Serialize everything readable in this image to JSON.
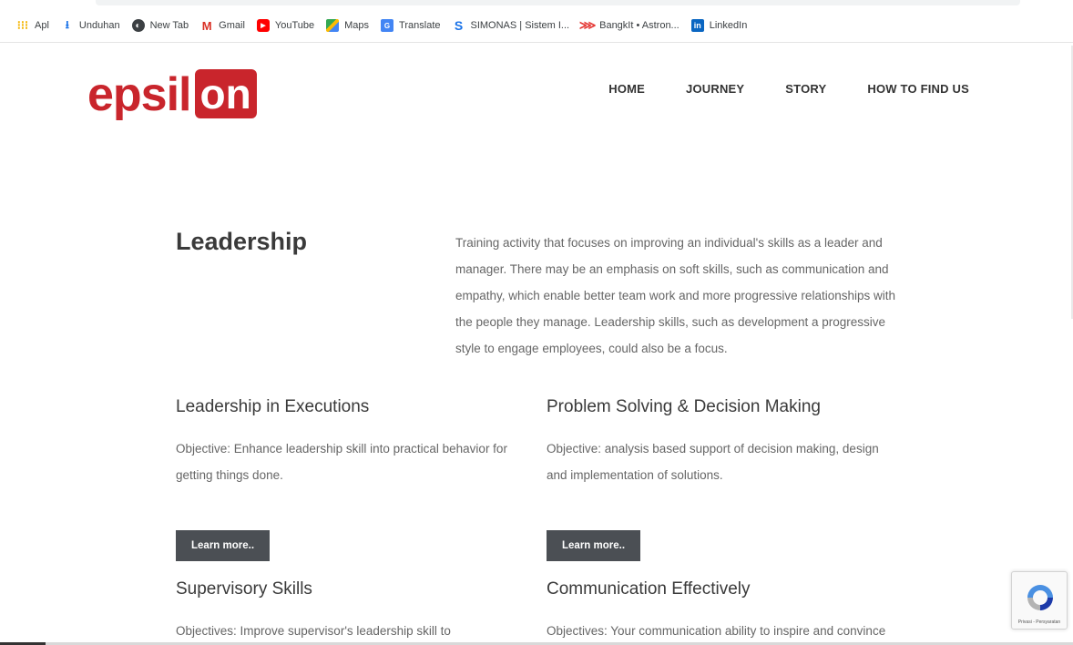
{
  "bookmarks": [
    {
      "label": "Apl",
      "icon": "apps-grid-icon",
      "color": "#f4b400"
    },
    {
      "label": "Unduhan",
      "icon": "download-icon",
      "color": "#1a73e8"
    },
    {
      "label": "New Tab",
      "icon": "globe-icon",
      "color": "#3c4043"
    },
    {
      "label": "Gmail",
      "icon": "gmail-icon",
      "color": "#d93025"
    },
    {
      "label": "YouTube",
      "icon": "youtube-icon",
      "color": "#ff0000"
    },
    {
      "label": "Maps",
      "icon": "maps-icon",
      "color": "#34a853"
    },
    {
      "label": "Translate",
      "icon": "translate-icon",
      "color": "#4285f4"
    },
    {
      "label": "SIMONAS | Sistem I...",
      "icon": "simonas-icon",
      "color": "#1a73e8"
    },
    {
      "label": "BangkIt • Astron...",
      "icon": "bangkit-icon",
      "color": "#e53935"
    },
    {
      "label": "LinkedIn",
      "icon": "linkedin-icon",
      "color": "#0a66c2"
    }
  ],
  "logo": {
    "part1": "epsil",
    "part2": "on",
    "color": "#c9252c"
  },
  "nav": [
    {
      "label": "HOME"
    },
    {
      "label": "JOURNEY"
    },
    {
      "label": "STORY"
    },
    {
      "label": "HOW TO FIND US"
    }
  ],
  "intro": {
    "title": "Leadership",
    "description": "Training activity that focuses on improving an individual's skills as a leader and manager. There may be an emphasis on soft skills, such as communication and empathy, which enable better team work and more progressive relationships with the people they manage. Leadership skills, such as development a progressive style to engage employees, could also be a focus."
  },
  "cards": [
    {
      "title": "Leadership in Executions",
      "objective": "Objective: Enhance leadership skill into practical behavior for getting things done.",
      "button": "Learn more.."
    },
    {
      "title": "Problem Solving & Decision Making",
      "objective": "Objective: analysis based support of decision making, design and implementation of solutions.",
      "button": "Learn more.."
    },
    {
      "title": "Supervisory Skills",
      "objective": "Objectives: Improve supervisor's leadership skill to communicate,"
    },
    {
      "title": "Communication Effectively",
      "objective": "Objectives: Your communication ability to inspire and convince is"
    }
  ],
  "recaptcha": {
    "label": "Privasi - Persyaratan"
  },
  "colors": {
    "button_bg": "#4b4f54",
    "heading": "#3a3a3a",
    "body_text": "#666666"
  }
}
